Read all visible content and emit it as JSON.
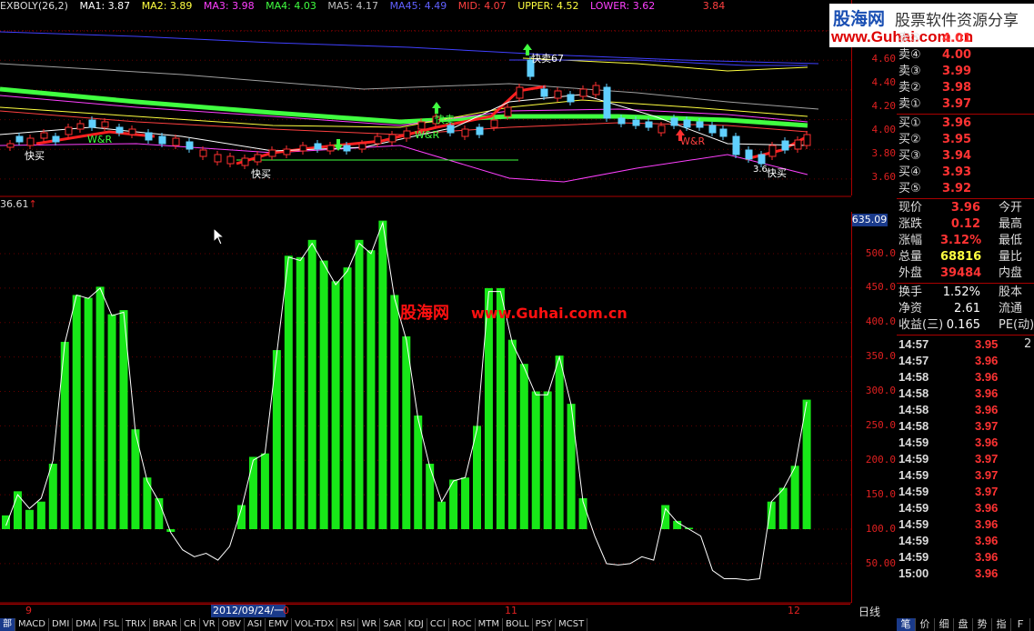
{
  "indicator_bar": {
    "name": "EXBOLY(26,2)",
    "ma1": "MA1: 3.87",
    "ma2": "MA2: 3.89",
    "ma3": "MA3: 3.98",
    "ma4": "MA4: 4.03",
    "ma5": "MA5: 4.17",
    "ma45": "MA45: 4.49",
    "mid": "MID: 4.07",
    "upper": "UPPER: 4.52",
    "lower": "LOWER: 3.62",
    "right_value": "3.84"
  },
  "colors": {
    "ma1": "#ffffff",
    "ma2": "#ffff40",
    "ma3": "#ff40ff",
    "ma4": "#40ff40",
    "ma5": "#a0a0a0",
    "ma45": "#4040ff",
    "mid": "#ff4040",
    "upper": "#ffff40",
    "lower": "#ff40ff",
    "volume": "#18e818"
  },
  "price_axis": [
    "4.60",
    "4.40",
    "4.20",
    "4.00",
    "3.80",
    "3.60"
  ],
  "volume_axis": [
    "500.0",
    "450.0",
    "400.0",
    "350.0",
    "300.0",
    "250.0",
    "200.0",
    "150.0",
    "100.0",
    "50.00"
  ],
  "volume_max_label": "635.09",
  "volume_left_label": "36.61",
  "chart_annotations": {
    "fast_buy_1": "快买",
    "wr_1": "W&R",
    "fast_buy_2": "快买",
    "fast_sell_1": "快卖",
    "wr_2": "W&R",
    "fast_sell_2": "快卖67",
    "wr_3": "W&R",
    "fast_buy_3": "快买",
    "price_note": "3.6"
  },
  "chart_data": {
    "type": "bar",
    "title": "",
    "ylabel": "",
    "ylim": [
      0,
      560
    ],
    "volume_bars": [
      120,
      155,
      128,
      140,
      195,
      372,
      440,
      436,
      452,
      412,
      418,
      245,
      175,
      145,
      100,
      0,
      0,
      0,
      0,
      0,
      135,
      205,
      210,
      360,
      497,
      495,
      520,
      490,
      460,
      480,
      520,
      505,
      548,
      440,
      380,
      265,
      195,
      140,
      172,
      175,
      250,
      450,
      450,
      375,
      340,
      300,
      300,
      352,
      282,
      145,
      0,
      0,
      0,
      0,
      0,
      0,
      135,
      112,
      102,
      0,
      0,
      0,
      0,
      0,
      0,
      140,
      160,
      192,
      288
    ],
    "kdj_line": [
      105,
      150,
      130,
      145,
      200,
      370,
      440,
      435,
      450,
      410,
      415,
      240,
      170,
      140,
      95,
      70,
      60,
      65,
      55,
      75,
      130,
      200,
      210,
      355,
      495,
      490,
      515,
      485,
      455,
      475,
      515,
      500,
      545,
      435,
      375,
      260,
      190,
      140,
      170,
      175,
      245,
      445,
      445,
      370,
      335,
      295,
      295,
      350,
      280,
      140,
      90,
      50,
      48,
      50,
      60,
      55,
      130,
      110,
      100,
      90,
      40,
      28,
      28,
      26,
      28,
      140,
      158,
      190,
      285
    ]
  },
  "date_axis": {
    "label_9": "9",
    "label_selected": "2012/09/24/一",
    "label_10": "0",
    "label_11": "11",
    "label_12": "12"
  },
  "period_label": "日线",
  "watermark": {
    "cn": "股海网",
    "url": "www.Guhai.com.cn"
  },
  "logo": {
    "name": "股海网",
    "slogan": "股票软件资源分享",
    "url": "www.Guhai.com.cn"
  },
  "order_book": {
    "sell": [
      {
        "label": "卖⑤",
        "price": "4.01"
      },
      {
        "label": "卖④",
        "price": "4.00"
      },
      {
        "label": "卖③",
        "price": "3.99"
      },
      {
        "label": "卖②",
        "price": "3.98"
      },
      {
        "label": "卖①",
        "price": "3.97"
      }
    ],
    "buy": [
      {
        "label": "买①",
        "price": "3.96"
      },
      {
        "label": "买②",
        "price": "3.95"
      },
      {
        "label": "买③",
        "price": "3.94"
      },
      {
        "label": "买④",
        "price": "3.93"
      },
      {
        "label": "买⑤",
        "price": "3.92"
      }
    ]
  },
  "quote": [
    {
      "label": "现价",
      "value": "3.96",
      "right": "今开",
      "color": "#ff3333"
    },
    {
      "label": "涨跌",
      "value": "0.12",
      "right": "最高",
      "color": "#ff3333"
    },
    {
      "label": "涨幅",
      "value": "3.12%",
      "right": "最低",
      "color": "#ff3333"
    },
    {
      "label": "总量",
      "value": "68816",
      "right": "量比",
      "color": "#ffff40"
    },
    {
      "label": "外盘",
      "value": "39484",
      "right": "内盘",
      "color": "#ff3333"
    }
  ],
  "fundamentals": [
    {
      "label": "换手",
      "value": "1.52%",
      "right": "股本"
    },
    {
      "label": "净资",
      "value": "2.61",
      "right": "流通"
    },
    {
      "label": "收益(三)",
      "value": "0.165",
      "right": "PE(动)"
    }
  ],
  "trades": [
    {
      "time": "14:57",
      "price": "3.95",
      "extra": "2"
    },
    {
      "time": "14:57",
      "price": "3.96",
      "extra": ""
    },
    {
      "time": "14:58",
      "price": "3.96",
      "extra": ""
    },
    {
      "time": "14:58",
      "price": "3.96",
      "extra": ""
    },
    {
      "time": "14:58",
      "price": "3.96",
      "extra": ""
    },
    {
      "time": "14:58",
      "price": "3.97",
      "extra": ""
    },
    {
      "time": "14:59",
      "price": "3.96",
      "extra": ""
    },
    {
      "time": "14:59",
      "price": "3.97",
      "extra": ""
    },
    {
      "time": "14:59",
      "price": "3.97",
      "extra": ""
    },
    {
      "time": "14:59",
      "price": "3.97",
      "extra": ""
    },
    {
      "time": "14:59",
      "price": "3.96",
      "extra": ""
    },
    {
      "time": "14:59",
      "price": "3.96",
      "extra": ""
    },
    {
      "time": "14:59",
      "price": "3.96",
      "extra": ""
    },
    {
      "time": "14:59",
      "price": "3.96",
      "extra": ""
    },
    {
      "time": "15:00",
      "price": "3.96",
      "extra": ""
    }
  ],
  "indicator_tabs": [
    "部",
    "MACD",
    "DMI",
    "DMA",
    "FSL",
    "TRIX",
    "BRAR",
    "CR",
    "VR",
    "OBV",
    "ASI",
    "EMV",
    "VOL-TDX",
    "RSI",
    "WR",
    "SAR",
    "KDJ",
    "CCI",
    "ROC",
    "MTM",
    "BOLL",
    "PSY",
    "MCST"
  ],
  "active_tab": "部",
  "right_tabs": [
    "笔",
    "价",
    "细",
    "盘",
    "势",
    "指",
    "Ｆ"
  ],
  "active_right_tab": "笔"
}
